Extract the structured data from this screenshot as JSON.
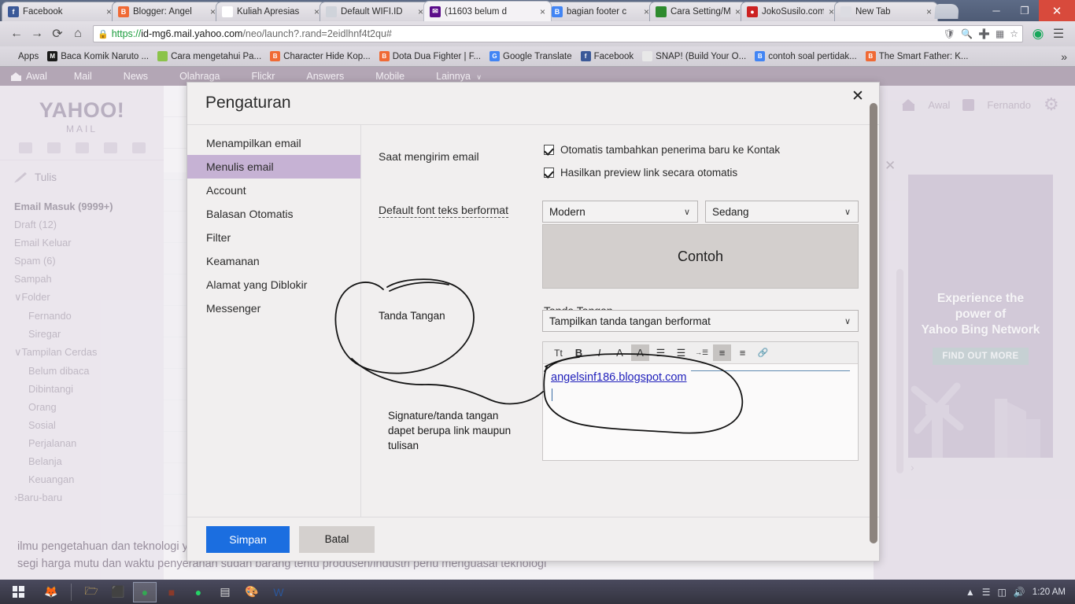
{
  "browser": {
    "tabs": [
      {
        "label": "Facebook",
        "icon": "facebook-icon",
        "color": "#3b5998",
        "glyph": "f",
        "active": false
      },
      {
        "label": "Blogger: Angel",
        "icon": "blogger-icon",
        "color": "#f06a35",
        "glyph": "B",
        "active": false
      },
      {
        "label": "Kuliah Apresias",
        "icon": "page-icon",
        "color": "#ffffff",
        "glyph": "",
        "active": false
      },
      {
        "label": "Default WIFI.ID",
        "icon": "page-icon",
        "color": "#cfd3da",
        "glyph": "",
        "active": false
      },
      {
        "label": "(11603 belum d",
        "icon": "yahoo-mail-icon",
        "color": "#5c0d8a",
        "glyph": "✉",
        "active": true
      },
      {
        "label": "bagian footer c",
        "icon": "blogger-square-icon",
        "color": "#4285f4",
        "glyph": "B",
        "active": false
      },
      {
        "label": "Cara Setting/M",
        "icon": "green-page-icon",
        "color": "#2e8b2e",
        "glyph": "",
        "active": false
      },
      {
        "label": "JokoSusilo.com",
        "icon": "ribbon-icon",
        "color": "#cc2222",
        "glyph": "●",
        "active": false
      },
      {
        "label": "New Tab",
        "icon": "new-tab-icon",
        "color": "#dcdce2",
        "glyph": "",
        "active": false
      }
    ],
    "window_controls": {
      "minimize": "─",
      "maximize": "❐",
      "close": "✕"
    },
    "nav": {
      "back": "←",
      "forward": "→",
      "reload": "⟳",
      "home": "⌂",
      "lock": "🔒",
      "url_scheme": "https://",
      "url_host": "id-mg6.mail.yahoo.com",
      "url_path": "/neo/launch?.rand=2eidlhnf4t2qu#",
      "omni_icons": [
        "shield-icon",
        "zoom-icon",
        "plus-circle-icon",
        "translate-icon",
        "star-icon"
      ],
      "profile_icon": "profile-icon",
      "menu_icon": "menu-icon"
    },
    "bookmarks": {
      "apps_label": "Apps",
      "items": [
        {
          "label": "Baca Komik Naruto ...",
          "color": "#1a1a1a",
          "glyph": "M"
        },
        {
          "label": "Cara mengetahui Pa...",
          "color": "#8bc34a",
          "glyph": ""
        },
        {
          "label": "Character Hide Kop...",
          "color": "#f06a35",
          "glyph": "B"
        },
        {
          "label": "Dota Dua Fighter | F...",
          "color": "#f06a35",
          "glyph": "B"
        },
        {
          "label": "Google Translate",
          "color": "#4285f4",
          "glyph": "G"
        },
        {
          "label": "Facebook",
          "color": "#3b5998",
          "glyph": "f"
        },
        {
          "label": "SNAP! (Build Your O...",
          "color": "#e8e8e8",
          "glyph": ""
        },
        {
          "label": "contoh soal pertidak...",
          "color": "#4285f4",
          "glyph": "B"
        },
        {
          "label": "The Smart Father: K...",
          "color": "#f06a35",
          "glyph": "B"
        }
      ],
      "overflow": "»"
    }
  },
  "yahoo": {
    "topnav": [
      "Awal",
      "Mail",
      "News",
      "Olahraga",
      "Flickr",
      "Answers",
      "Mobile",
      "Lainnya"
    ],
    "topnav_caret": "∨",
    "logo_main": "YAHOO!",
    "logo_sub": "MAIL",
    "compose_label": "Tulis",
    "folders": [
      {
        "label": "Email Masuk (9999+)",
        "bold": true,
        "indent": 0
      },
      {
        "label": "Draft (12)",
        "bold": false,
        "indent": 0
      },
      {
        "label": "Email Keluar",
        "bold": false,
        "indent": 0
      },
      {
        "label": "Spam (6)",
        "bold": false,
        "indent": 0
      },
      {
        "label": "Sampah",
        "bold": false,
        "indent": 0
      },
      {
        "label": "Folder",
        "bold": false,
        "indent": 0,
        "caret": "∨"
      },
      {
        "label": "Fernando",
        "bold": false,
        "indent": 1
      },
      {
        "label": "Siregar",
        "bold": false,
        "indent": 1
      },
      {
        "label": "Tampilan Cerdas",
        "bold": false,
        "indent": 0,
        "caret": "∨"
      },
      {
        "label": "Belum dibaca",
        "bold": false,
        "indent": 1
      },
      {
        "label": "Dibintangi",
        "bold": false,
        "indent": 1
      },
      {
        "label": "Orang",
        "bold": false,
        "indent": 1
      },
      {
        "label": "Sosial",
        "bold": false,
        "indent": 1
      },
      {
        "label": "Perjalanan",
        "bold": false,
        "indent": 1
      },
      {
        "label": "Belanja",
        "bold": false,
        "indent": 1
      },
      {
        "label": "Keuangan",
        "bold": false,
        "indent": 1
      },
      {
        "label": "Baru-baru",
        "bold": false,
        "indent": 0,
        "caret": "›"
      }
    ],
    "userbar": {
      "home": "Awal",
      "user": "Fernando",
      "settings_icon": "gear-icon"
    },
    "ad": {
      "line1": "Experience the",
      "line2": "power of",
      "line3": "Yahoo Bing Network",
      "cta": "FIND OUT MORE",
      "close_icon": "close-icon"
    },
    "background_text_line1": "ilmu pengetahuan dan teknologi yanp pesat dan canggin. Untuk menghasilkan produk yang kompetitif dari",
    "background_text_line2": "segi harga mutu dan waktu penyerahan sudah barang tentu produsen/industri perlu menguasai teknologi"
  },
  "dialog": {
    "title": "Pengaturan",
    "close_icon": "close-icon",
    "nav_items": [
      {
        "label": "Menampilkan email",
        "active": false
      },
      {
        "label": "Menulis email",
        "active": true
      },
      {
        "label": "Account",
        "active": false
      },
      {
        "label": "Balasan Otomatis",
        "active": false
      },
      {
        "label": "Filter",
        "active": false
      },
      {
        "label": "Keamanan",
        "active": false
      },
      {
        "label": "Alamat yang Diblokir",
        "active": false
      },
      {
        "label": "Messenger",
        "active": false
      }
    ],
    "sending_label": "Saat mengirim email",
    "checkboxes": [
      {
        "label": "Otomatis tambahkan penerima baru ke Kontak",
        "checked": true
      },
      {
        "label": "Hasilkan preview link secara otomatis",
        "checked": true
      }
    ],
    "font_label": "Default font teks berformat",
    "font_family_value": "Modern",
    "font_size_value": "Sedang",
    "preview_text": "Contoh",
    "signature_label": "Tanda Tangan",
    "signature_mode_value": "Tampilkan tanda tangan berformat",
    "toolbar_buttons": [
      {
        "name": "font-size-icon",
        "glyph": "Tt",
        "active": false
      },
      {
        "name": "bold-icon",
        "glyph": "B",
        "active": false
      },
      {
        "name": "italic-icon",
        "glyph": "I",
        "active": false
      },
      {
        "name": "font-color-icon",
        "glyph": "A",
        "active": false
      },
      {
        "name": "highlight-color-icon",
        "glyph": "A",
        "active": true
      },
      {
        "name": "bulleted-list-icon",
        "glyph": "☰",
        "active": false
      },
      {
        "name": "numbered-list-icon",
        "glyph": "☰",
        "active": false
      },
      {
        "name": "indent-icon",
        "glyph": "→☰",
        "active": false
      },
      {
        "name": "align-left-icon",
        "glyph": "≡",
        "active": true
      },
      {
        "name": "align-center-icon",
        "glyph": "≡",
        "active": false
      },
      {
        "name": "insert-link-icon",
        "glyph": "🔗",
        "active": false
      }
    ],
    "signature_content": "angelsinf186.blogspot.com",
    "save_label": "Simpan",
    "cancel_label": "Batal",
    "caret_symbol": "∨"
  },
  "annotations": [
    {
      "name": "annotation-tanda-tangan",
      "text": "Tanda Tangan"
    },
    {
      "name": "annotation-signature-note",
      "text": "Signature/tanda tangan\ndapet berupa link maupun\ntulisan"
    }
  ],
  "annotation_note_lines": [
    "Signature/tanda tangan",
    "dapet berupa link maupun",
    "tulisan"
  ],
  "taskbar": {
    "start_icon": "windows-start-icon",
    "items": [
      {
        "name": "firefox-icon",
        "glyph": "🦊",
        "color": "#e8701a",
        "active": false
      },
      {
        "name": "file-explorer-icon",
        "glyph": "🗁",
        "color": "#e8c060",
        "active": false
      },
      {
        "name": "idm-icon",
        "glyph": "⬛",
        "color": "#d96a2a",
        "active": false
      },
      {
        "name": "chrome-icon",
        "glyph": "●",
        "color": "#34a853",
        "active": true
      },
      {
        "name": "media-player-icon",
        "glyph": "■",
        "color": "#8a3a2a",
        "active": false
      },
      {
        "name": "whatsapp-icon",
        "glyph": "●",
        "color": "#25d366",
        "active": false
      },
      {
        "name": "notepad-icon",
        "glyph": "▤",
        "color": "#d8d8d8",
        "active": false
      },
      {
        "name": "paint-icon",
        "glyph": "🎨",
        "color": "#c0c0e0",
        "active": false
      },
      {
        "name": "word-icon",
        "glyph": "W",
        "color": "#2b579a",
        "active": false
      }
    ],
    "tray": {
      "expand": "▲",
      "network_icon": "signal-icon",
      "battery_icon": "battery-icon",
      "volume_icon": "volume-icon",
      "clock": "1:20 AM"
    }
  }
}
